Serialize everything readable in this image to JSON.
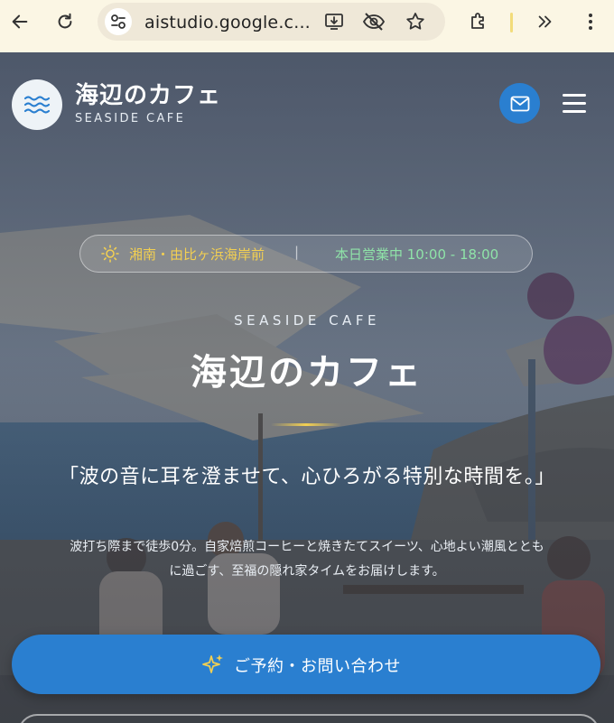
{
  "browser": {
    "url": "aistudio.google.c...",
    "icons": [
      "back-icon",
      "reload-icon",
      "site-settings-icon",
      "install-app-icon",
      "eye-off-icon",
      "star-icon",
      "extensions-icon",
      "chevron-double-right-icon",
      "more-vert-icon"
    ]
  },
  "header": {
    "logo_icon": "waves-icon",
    "title": "海辺のカフェ",
    "subtitle": "SEASIDE CAFE",
    "mail_icon": "mail-icon",
    "menu_icon": "hamburger-menu-icon"
  },
  "info_pill": {
    "location_icon": "sun-icon",
    "location": "湘南・由比ヶ浜海岸前",
    "separator": "|",
    "hours": "本日営業中 10:00 - 18:00"
  },
  "hero": {
    "eyebrow": "SEASIDE CAFE",
    "title": "海辺のカフェ",
    "quote": "「波の音に耳を澄ませて、心ひろがる特別な時間を。」",
    "description_line1": "波打ち際まで徒歩0分。自家焙煎コーヒーと焼きたてスイーツ、心地よい潮風ととも",
    "description_line2": "に過ごす、至福の隠れ家タイムをお届けします。"
  },
  "cta": {
    "icon": "sparkles-icon",
    "label": "ご予約・お問い合わせ"
  },
  "colors": {
    "accent": "#2a7fd0",
    "gold": "#f2cf52",
    "green": "#8fe3a8",
    "chrome_bg": "#fbf6e4"
  }
}
